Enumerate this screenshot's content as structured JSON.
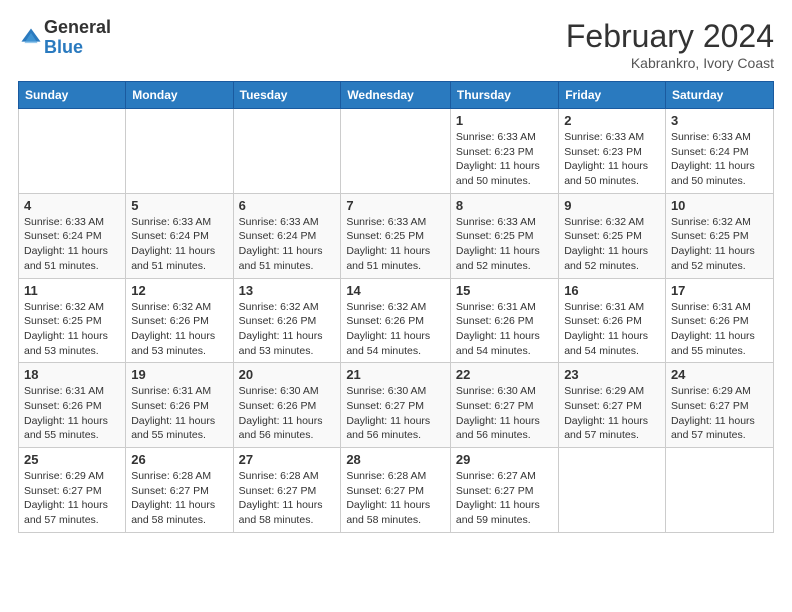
{
  "logo": {
    "general": "General",
    "blue": "Blue"
  },
  "title": {
    "month": "February 2024",
    "location": "Kabrankro, Ivory Coast"
  },
  "weekdays": [
    "Sunday",
    "Monday",
    "Tuesday",
    "Wednesday",
    "Thursday",
    "Friday",
    "Saturday"
  ],
  "weeks": [
    [
      {
        "day": "",
        "info": ""
      },
      {
        "day": "",
        "info": ""
      },
      {
        "day": "",
        "info": ""
      },
      {
        "day": "",
        "info": ""
      },
      {
        "day": "1",
        "info": "Sunrise: 6:33 AM\nSunset: 6:23 PM\nDaylight: 11 hours\nand 50 minutes."
      },
      {
        "day": "2",
        "info": "Sunrise: 6:33 AM\nSunset: 6:23 PM\nDaylight: 11 hours\nand 50 minutes."
      },
      {
        "day": "3",
        "info": "Sunrise: 6:33 AM\nSunset: 6:24 PM\nDaylight: 11 hours\nand 50 minutes."
      }
    ],
    [
      {
        "day": "4",
        "info": "Sunrise: 6:33 AM\nSunset: 6:24 PM\nDaylight: 11 hours\nand 51 minutes."
      },
      {
        "day": "5",
        "info": "Sunrise: 6:33 AM\nSunset: 6:24 PM\nDaylight: 11 hours\nand 51 minutes."
      },
      {
        "day": "6",
        "info": "Sunrise: 6:33 AM\nSunset: 6:24 PM\nDaylight: 11 hours\nand 51 minutes."
      },
      {
        "day": "7",
        "info": "Sunrise: 6:33 AM\nSunset: 6:25 PM\nDaylight: 11 hours\nand 51 minutes."
      },
      {
        "day": "8",
        "info": "Sunrise: 6:33 AM\nSunset: 6:25 PM\nDaylight: 11 hours\nand 52 minutes."
      },
      {
        "day": "9",
        "info": "Sunrise: 6:32 AM\nSunset: 6:25 PM\nDaylight: 11 hours\nand 52 minutes."
      },
      {
        "day": "10",
        "info": "Sunrise: 6:32 AM\nSunset: 6:25 PM\nDaylight: 11 hours\nand 52 minutes."
      }
    ],
    [
      {
        "day": "11",
        "info": "Sunrise: 6:32 AM\nSunset: 6:25 PM\nDaylight: 11 hours\nand 53 minutes."
      },
      {
        "day": "12",
        "info": "Sunrise: 6:32 AM\nSunset: 6:26 PM\nDaylight: 11 hours\nand 53 minutes."
      },
      {
        "day": "13",
        "info": "Sunrise: 6:32 AM\nSunset: 6:26 PM\nDaylight: 11 hours\nand 53 minutes."
      },
      {
        "day": "14",
        "info": "Sunrise: 6:32 AM\nSunset: 6:26 PM\nDaylight: 11 hours\nand 54 minutes."
      },
      {
        "day": "15",
        "info": "Sunrise: 6:31 AM\nSunset: 6:26 PM\nDaylight: 11 hours\nand 54 minutes."
      },
      {
        "day": "16",
        "info": "Sunrise: 6:31 AM\nSunset: 6:26 PM\nDaylight: 11 hours\nand 54 minutes."
      },
      {
        "day": "17",
        "info": "Sunrise: 6:31 AM\nSunset: 6:26 PM\nDaylight: 11 hours\nand 55 minutes."
      }
    ],
    [
      {
        "day": "18",
        "info": "Sunrise: 6:31 AM\nSunset: 6:26 PM\nDaylight: 11 hours\nand 55 minutes."
      },
      {
        "day": "19",
        "info": "Sunrise: 6:31 AM\nSunset: 6:26 PM\nDaylight: 11 hours\nand 55 minutes."
      },
      {
        "day": "20",
        "info": "Sunrise: 6:30 AM\nSunset: 6:26 PM\nDaylight: 11 hours\nand 56 minutes."
      },
      {
        "day": "21",
        "info": "Sunrise: 6:30 AM\nSunset: 6:27 PM\nDaylight: 11 hours\nand 56 minutes."
      },
      {
        "day": "22",
        "info": "Sunrise: 6:30 AM\nSunset: 6:27 PM\nDaylight: 11 hours\nand 56 minutes."
      },
      {
        "day": "23",
        "info": "Sunrise: 6:29 AM\nSunset: 6:27 PM\nDaylight: 11 hours\nand 57 minutes."
      },
      {
        "day": "24",
        "info": "Sunrise: 6:29 AM\nSunset: 6:27 PM\nDaylight: 11 hours\nand 57 minutes."
      }
    ],
    [
      {
        "day": "25",
        "info": "Sunrise: 6:29 AM\nSunset: 6:27 PM\nDaylight: 11 hours\nand 57 minutes."
      },
      {
        "day": "26",
        "info": "Sunrise: 6:28 AM\nSunset: 6:27 PM\nDaylight: 11 hours\nand 58 minutes."
      },
      {
        "day": "27",
        "info": "Sunrise: 6:28 AM\nSunset: 6:27 PM\nDaylight: 11 hours\nand 58 minutes."
      },
      {
        "day": "28",
        "info": "Sunrise: 6:28 AM\nSunset: 6:27 PM\nDaylight: 11 hours\nand 58 minutes."
      },
      {
        "day": "29",
        "info": "Sunrise: 6:27 AM\nSunset: 6:27 PM\nDaylight: 11 hours\nand 59 minutes."
      },
      {
        "day": "",
        "info": ""
      },
      {
        "day": "",
        "info": ""
      }
    ]
  ]
}
